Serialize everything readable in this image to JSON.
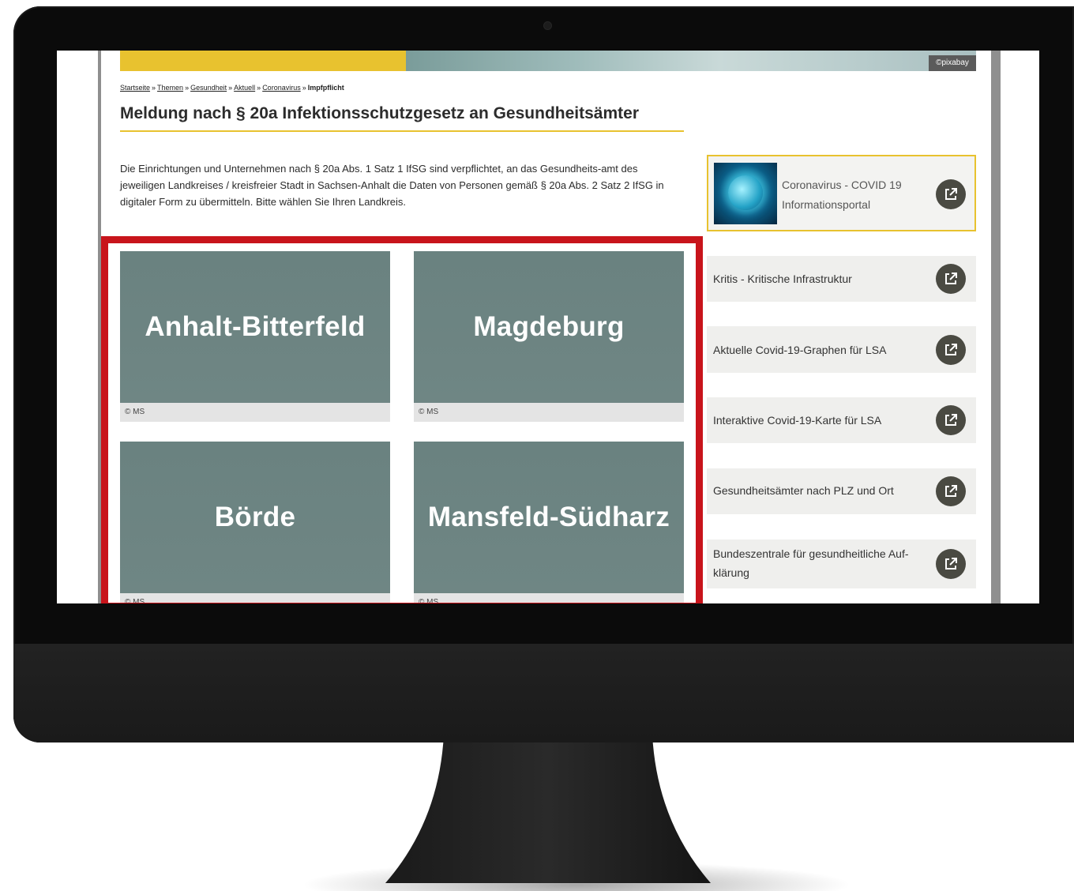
{
  "hero": {
    "credit": "©pixabay"
  },
  "breadcrumb": {
    "items": [
      "Startseite",
      "Themen",
      "Gesundheit",
      "Aktuell",
      "Coronavirus"
    ],
    "separator": "»",
    "current": "Impfpflicht"
  },
  "page_title": "Meldung nach § 20a Infektionsschutzgesetz an Gesundheitsämter",
  "intro": "Die Einrichtungen und Unternehmen nach § 20a Abs. 1 Satz 1 IfSG sind verpflichtet, an das Gesundheits-amt des jeweiligen Landkreises / kreisfreier Stadt in Sachsen-Anhalt die Daten von Personen gemäß § 20a Abs. 2 Satz 2 IfSG in digitaler Form zu übermitteln. Bitte wählen Sie Ihren Landkreis.",
  "tiles": [
    {
      "label": "Anhalt-Bitterfeld",
      "credit": "© MS"
    },
    {
      "label": "Magdeburg",
      "credit": "© MS"
    },
    {
      "label": "Börde",
      "credit": "© MS"
    },
    {
      "label": "Mansfeld-Südharz",
      "credit": "© MS"
    }
  ],
  "sidebar": {
    "featured": {
      "label": "Coronavirus - COVID 19 Informationsportal"
    },
    "links": [
      {
        "label": "Kritis - Kritische Infrastruktur"
      },
      {
        "label": "Aktuelle Covid-19-Graphen für LSA"
      },
      {
        "label": "Interaktive Covid-19-Karte für LSA"
      },
      {
        "label": "Gesundheitsämter nach PLZ und Ort"
      },
      {
        "label": "Bundeszentrale für gesundheitliche Auf-klärung"
      }
    ]
  },
  "colors": {
    "accent_yellow": "#e8c22f",
    "highlight_red": "#c8141b",
    "tile_bg": "#6a8280",
    "button_dark": "#4a4a42"
  },
  "icons": {
    "external_link": "external-link-icon"
  }
}
